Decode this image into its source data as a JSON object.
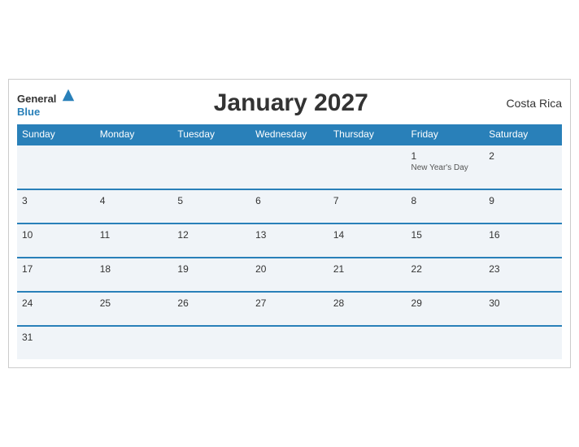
{
  "header": {
    "logo_general": "General",
    "logo_blue": "Blue",
    "title": "January 2027",
    "country": "Costa Rica"
  },
  "days_of_week": [
    "Sunday",
    "Monday",
    "Tuesday",
    "Wednesday",
    "Thursday",
    "Friday",
    "Saturday"
  ],
  "weeks": [
    [
      {
        "day": "",
        "event": ""
      },
      {
        "day": "",
        "event": ""
      },
      {
        "day": "",
        "event": ""
      },
      {
        "day": "",
        "event": ""
      },
      {
        "day": "",
        "event": ""
      },
      {
        "day": "1",
        "event": "New Year's Day"
      },
      {
        "day": "2",
        "event": ""
      }
    ],
    [
      {
        "day": "3",
        "event": ""
      },
      {
        "day": "4",
        "event": ""
      },
      {
        "day": "5",
        "event": ""
      },
      {
        "day": "6",
        "event": ""
      },
      {
        "day": "7",
        "event": ""
      },
      {
        "day": "8",
        "event": ""
      },
      {
        "day": "9",
        "event": ""
      }
    ],
    [
      {
        "day": "10",
        "event": ""
      },
      {
        "day": "11",
        "event": ""
      },
      {
        "day": "12",
        "event": ""
      },
      {
        "day": "13",
        "event": ""
      },
      {
        "day": "14",
        "event": ""
      },
      {
        "day": "15",
        "event": ""
      },
      {
        "day": "16",
        "event": ""
      }
    ],
    [
      {
        "day": "17",
        "event": ""
      },
      {
        "day": "18",
        "event": ""
      },
      {
        "day": "19",
        "event": ""
      },
      {
        "day": "20",
        "event": ""
      },
      {
        "day": "21",
        "event": ""
      },
      {
        "day": "22",
        "event": ""
      },
      {
        "day": "23",
        "event": ""
      }
    ],
    [
      {
        "day": "24",
        "event": ""
      },
      {
        "day": "25",
        "event": ""
      },
      {
        "day": "26",
        "event": ""
      },
      {
        "day": "27",
        "event": ""
      },
      {
        "day": "28",
        "event": ""
      },
      {
        "day": "29",
        "event": ""
      },
      {
        "day": "30",
        "event": ""
      }
    ],
    [
      {
        "day": "31",
        "event": ""
      },
      {
        "day": "",
        "event": ""
      },
      {
        "day": "",
        "event": ""
      },
      {
        "day": "",
        "event": ""
      },
      {
        "day": "",
        "event": ""
      },
      {
        "day": "",
        "event": ""
      },
      {
        "day": "",
        "event": ""
      }
    ]
  ]
}
